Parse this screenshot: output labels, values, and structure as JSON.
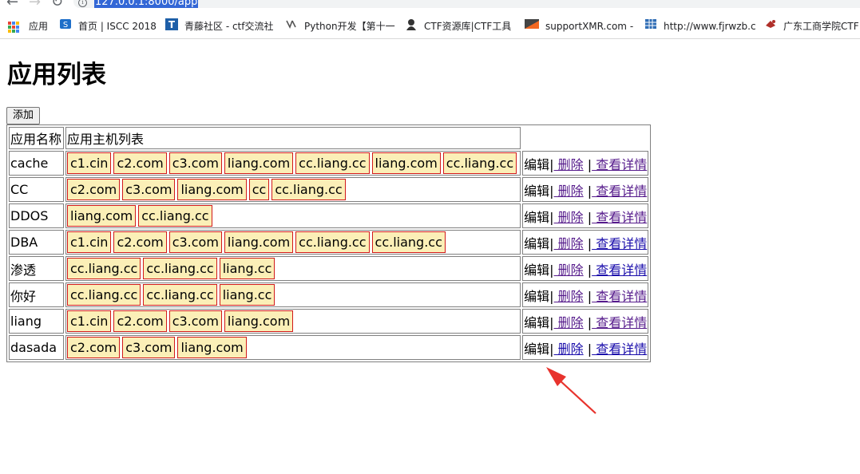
{
  "browser": {
    "url": "127.0.0.1:8000/app",
    "bookmarks": [
      {
        "label": "应用",
        "icon": "apps-grid-icon"
      },
      {
        "label": "首页 | ISCC 2018",
        "icon": "iscc-icon"
      },
      {
        "label": "青藤社区 - ctf交流社",
        "icon": "t-logo-icon"
      },
      {
        "label": "Python开发【第十一",
        "icon": "python-icon"
      },
      {
        "label": "CTF资源库|CTF工具",
        "icon": "hacker-icon"
      },
      {
        "label": "supportXMR.com -",
        "icon": "xmr-icon"
      },
      {
        "label": "http://www.fjrwzb.c",
        "icon": "grid-icon"
      },
      {
        "label": "广东工商学院CTF",
        "icon": "school-icon"
      }
    ]
  },
  "page": {
    "title": "应用列表",
    "add_button": "添加",
    "table": {
      "headers": [
        "应用名称",
        "应用主机列表"
      ],
      "rows": [
        {
          "name": "cache",
          "hosts": [
            "c1.cin",
            "c2.com",
            "c3.com",
            "liang.com",
            "cc.liang.cc",
            "liang.com",
            "cc.liang.cc"
          ]
        },
        {
          "name": "CC",
          "hosts": [
            "c2.com",
            "c3.com",
            "liang.com",
            "cc",
            "cc.liang.cc"
          ]
        },
        {
          "name": "DDOS",
          "hosts": [
            "liang.com",
            "cc.liang.cc"
          ]
        },
        {
          "name": "DBA",
          "hosts": [
            "c1.cin",
            "c2.com",
            "c3.com",
            "liang.com",
            "cc.liang.cc",
            "cc.liang.cc"
          ]
        },
        {
          "name": "渗透",
          "hosts": [
            "cc.liang.cc",
            "cc.liang.cc",
            "liang.cc"
          ]
        },
        {
          "name": "你好",
          "hosts": [
            "cc.liang.cc",
            "cc.liang.cc",
            "liang.cc"
          ]
        },
        {
          "name": "liang",
          "hosts": [
            "c1.cin",
            "c2.com",
            "c3.com",
            "liang.com"
          ]
        },
        {
          "name": "dasada",
          "hosts": [
            "c2.com",
            "c3.com",
            "liang.com"
          ]
        }
      ],
      "actions": {
        "edit": "编辑",
        "sep": "|",
        "delete": " 删除",
        "detail": " 查看详情"
      }
    }
  },
  "colors": {
    "host_tag_bg": "#fbefb7",
    "host_tag_border": "#d11a1a",
    "annotation_arrow": "#e8332d"
  }
}
